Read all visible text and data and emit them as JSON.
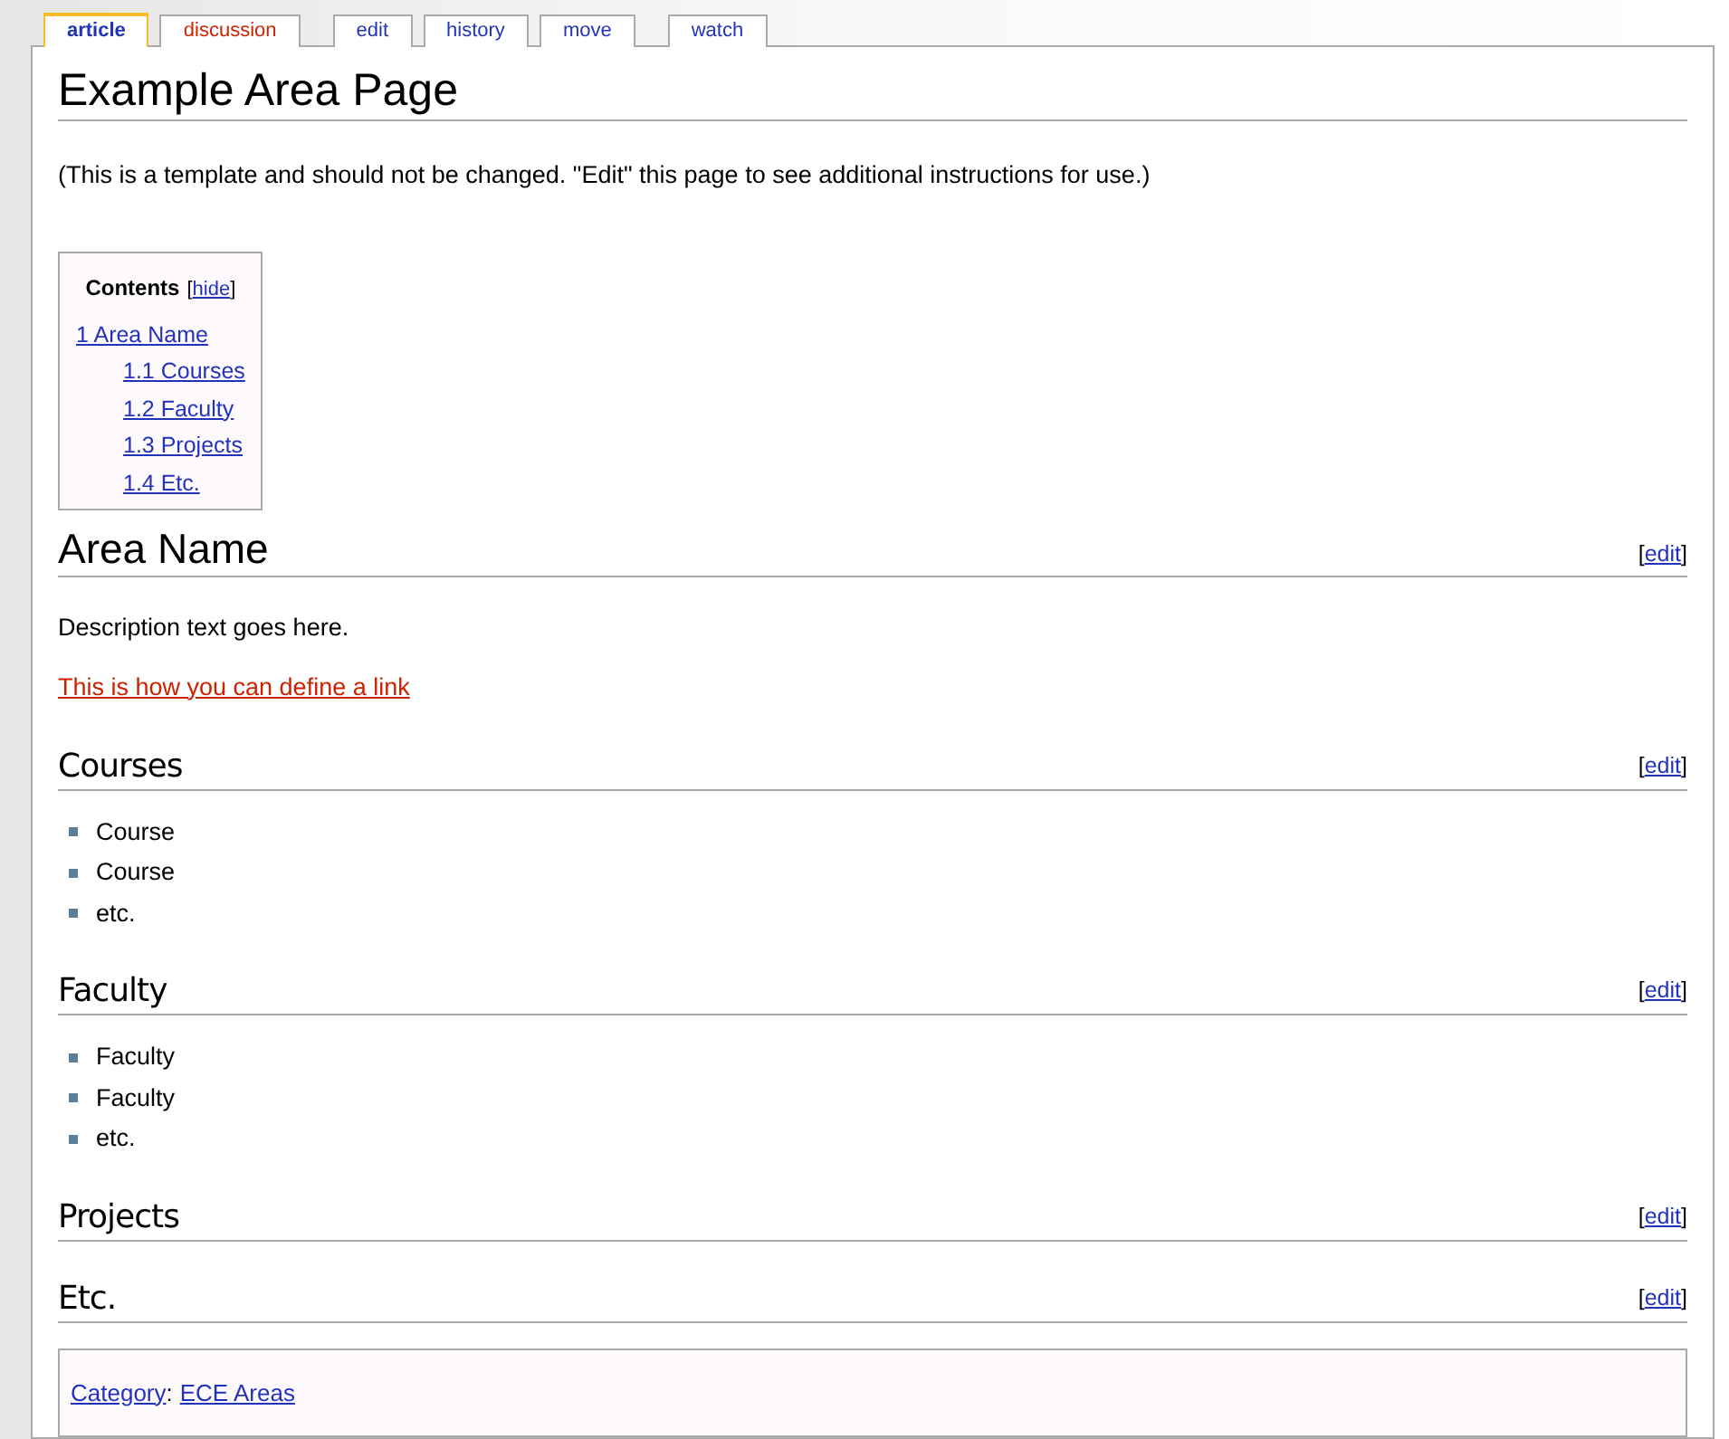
{
  "tab_groups": [
    [
      {
        "label": "article",
        "selected": true,
        "exists": true
      },
      {
        "label": "discussion",
        "selected": false,
        "exists": false
      }
    ],
    [
      {
        "label": "edit",
        "selected": false,
        "exists": true
      },
      {
        "label": "history",
        "selected": false,
        "exists": true
      },
      {
        "label": "move",
        "selected": false,
        "exists": true
      }
    ],
    [
      {
        "label": "watch",
        "selected": false,
        "exists": true
      }
    ]
  ],
  "title": "Example Area Page",
  "intro": "(This is a template and should not be changed. \"Edit\" this page to see additional instructions for use.)",
  "toc": {
    "title": "Contents",
    "open": "[",
    "toggle": "hide",
    "close": "]",
    "items": [
      {
        "label": "1 Area Name",
        "children": [
          {
            "label": "1.1 Courses"
          },
          {
            "label": "1.2 Faculty"
          },
          {
            "label": "1.3 Projects"
          },
          {
            "label": "1.4 Etc."
          }
        ]
      }
    ]
  },
  "sections": [
    {
      "kind": "h2",
      "heading": "Area Name",
      "open": "[",
      "edit": "edit",
      "close": "]",
      "blocks": [
        {
          "kind": "paragraph",
          "text": "Description text goes here."
        },
        {
          "kind": "redlink",
          "text": "This is how you can define a link"
        }
      ]
    },
    {
      "kind": "h3",
      "heading": "Courses",
      "open": "[",
      "edit": "edit",
      "close": "]",
      "blocks": [
        {
          "kind": "list",
          "items": [
            "Course",
            "Course",
            "etc."
          ]
        }
      ]
    },
    {
      "kind": "h3",
      "heading": "Faculty",
      "open": "[",
      "edit": "edit",
      "close": "]",
      "blocks": [
        {
          "kind": "list",
          "items": [
            "Faculty",
            "Faculty",
            "etc."
          ]
        }
      ]
    },
    {
      "kind": "h3",
      "heading": "Projects",
      "open": "[",
      "edit": "edit",
      "close": "]"
    },
    {
      "kind": "h3",
      "heading": "Etc.",
      "open": "[",
      "edit": "edit",
      "close": "]"
    }
  ],
  "categories": {
    "label": "Category",
    "sep": ":",
    "links": [
      "ECE Areas"
    ]
  }
}
